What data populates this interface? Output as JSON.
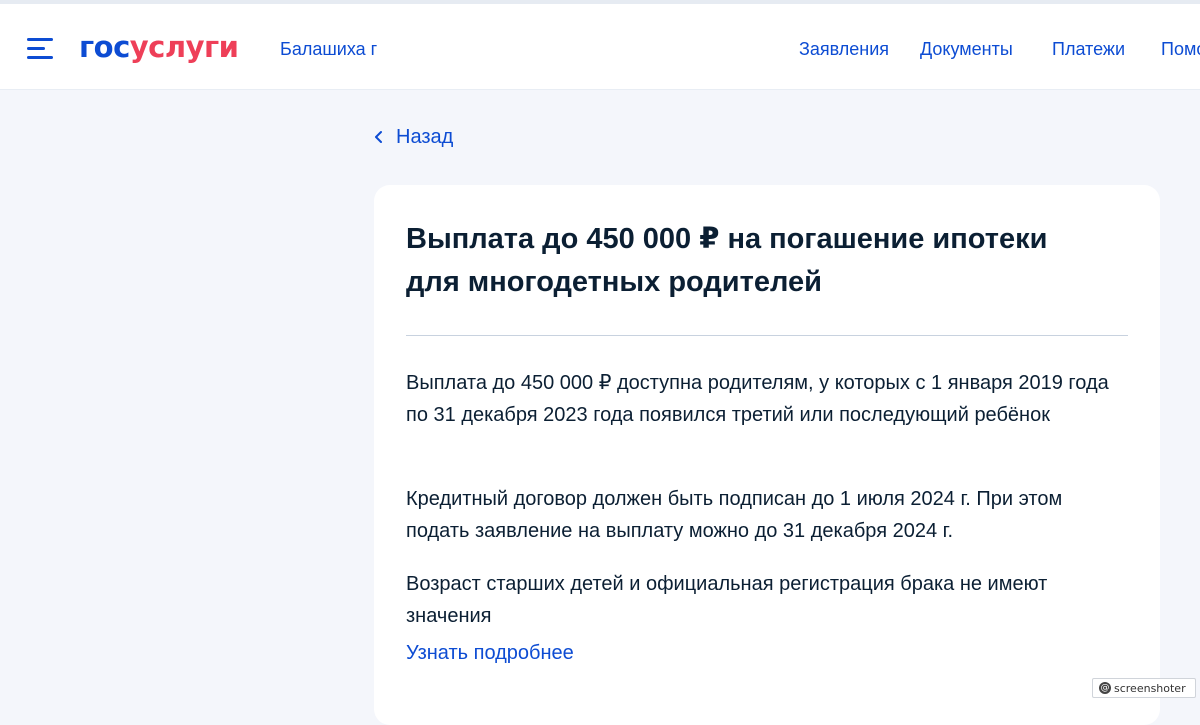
{
  "header": {
    "logo_part1": "гос",
    "logo_part2": "услуги",
    "city": "Балашиха г",
    "nav": [
      "Заявления",
      "Документы",
      "Платежи",
      "Помощь"
    ]
  },
  "back_label": "Назад",
  "card": {
    "title": "Выплата до 450 000 ₽ на погашение ипотеки для многодетных родителей",
    "paragraphs": [
      "Выплата до 450 000 ₽ доступна родителям, у которых с 1 января 2019 года по 31 декабря 2023 года появился третий или последующий ребёнок",
      "Кредитный договор должен быть подписан до 1 июля 2024 г. При этом подать заявление на выплату можно до 31 декабря 2024 г.",
      "Возраст старших детей и официальная регистрация брака не имеют значения"
    ],
    "more_link": "Узнать подробнее"
  },
  "watermark": "screenshoter",
  "colors": {
    "brand_blue": "#0d4cd3",
    "brand_red": "#ee3f58",
    "text": "#0b1f33",
    "bg": "#f4f6fb"
  }
}
